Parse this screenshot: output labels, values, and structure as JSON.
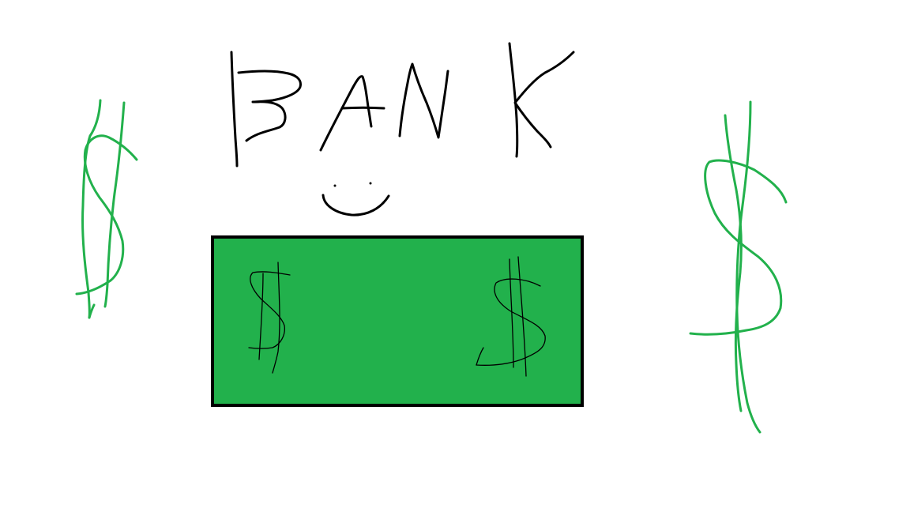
{
  "drawing": {
    "heading": "BANK",
    "colors": {
      "background": "#ffffff",
      "ink": "#000000",
      "money_green": "#22b14c",
      "bill_border": "#000000"
    },
    "elements": [
      "bank-heading",
      "smiley-face",
      "dollar-bill",
      "dollar-sign-left",
      "dollar-sign-right"
    ]
  }
}
